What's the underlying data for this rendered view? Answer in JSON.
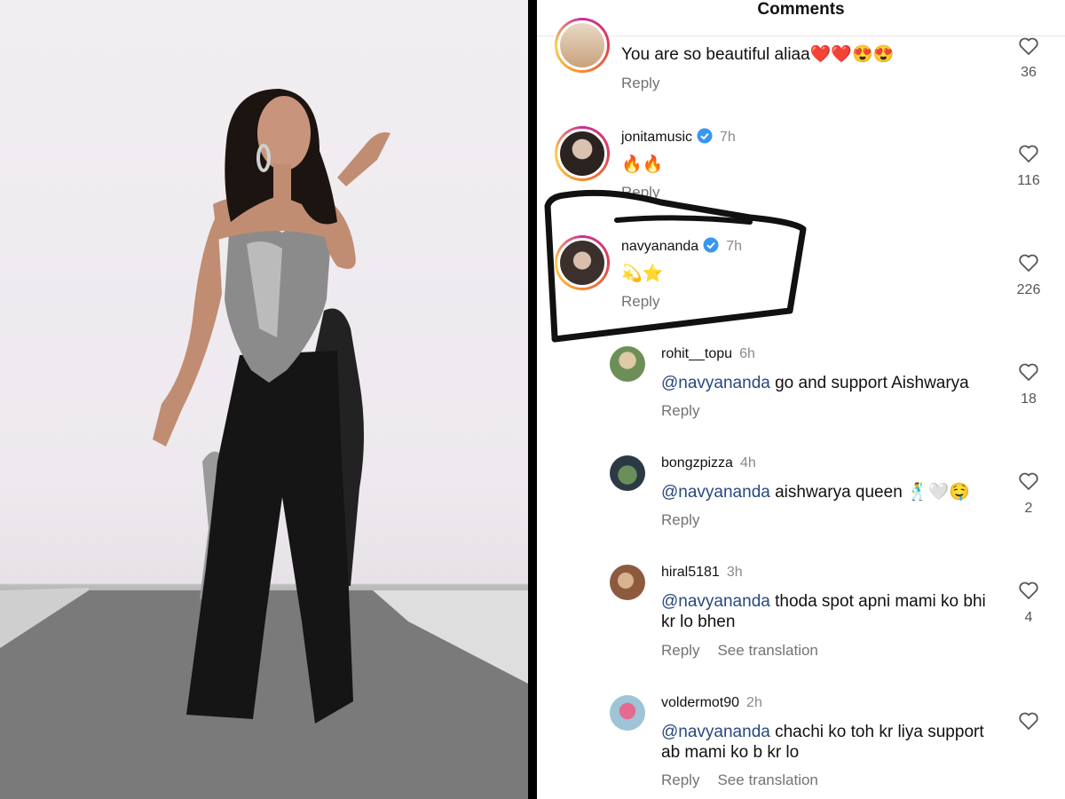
{
  "panel": {
    "title": "Comments"
  },
  "comments": [
    {
      "username": "",
      "time": "",
      "text": "You are so beautiful aliaa❤️❤️😍😍",
      "reply": "Reply",
      "likes": "36"
    },
    {
      "username": "jonitamusic",
      "time": "7h",
      "text": "🔥🔥",
      "reply": "Reply",
      "likes": "116",
      "verified": true
    },
    {
      "username": "navyananda",
      "time": "7h",
      "text": "💫⭐",
      "reply": "Reply",
      "likes": "226",
      "verified": true
    },
    {
      "username": "rohit__topu",
      "time": "6h",
      "mention": "@navyananda",
      "text": " go and support Aishwarya",
      "reply": "Reply",
      "likes": "18"
    },
    {
      "username": "bongzpizza",
      "time": "4h",
      "mention": "@navyananda",
      "text": " aishwarya queen 🕺🤍🤤",
      "reply": "Reply",
      "likes": "2"
    },
    {
      "username": "hiral5181",
      "time": "3h",
      "mention": "@navyananda",
      "text": " thoda spot apni mami ko bhi kr lo bhen",
      "reply": "Reply",
      "see_translation": "See translation",
      "likes": "4"
    },
    {
      "username": "voldermot90",
      "time": "2h",
      "mention": "@navyananda",
      "text": " chachi ko toh kr liya support ab mami ko b kr lo",
      "reply": "Reply",
      "see_translation": "See translation",
      "likes": ""
    }
  ],
  "colors": {
    "verified": "#3897f0",
    "mention": "#27497e",
    "secondary": "#737373"
  },
  "icons": {
    "like": "heart-outline-icon",
    "verified": "verified-badge-icon"
  }
}
